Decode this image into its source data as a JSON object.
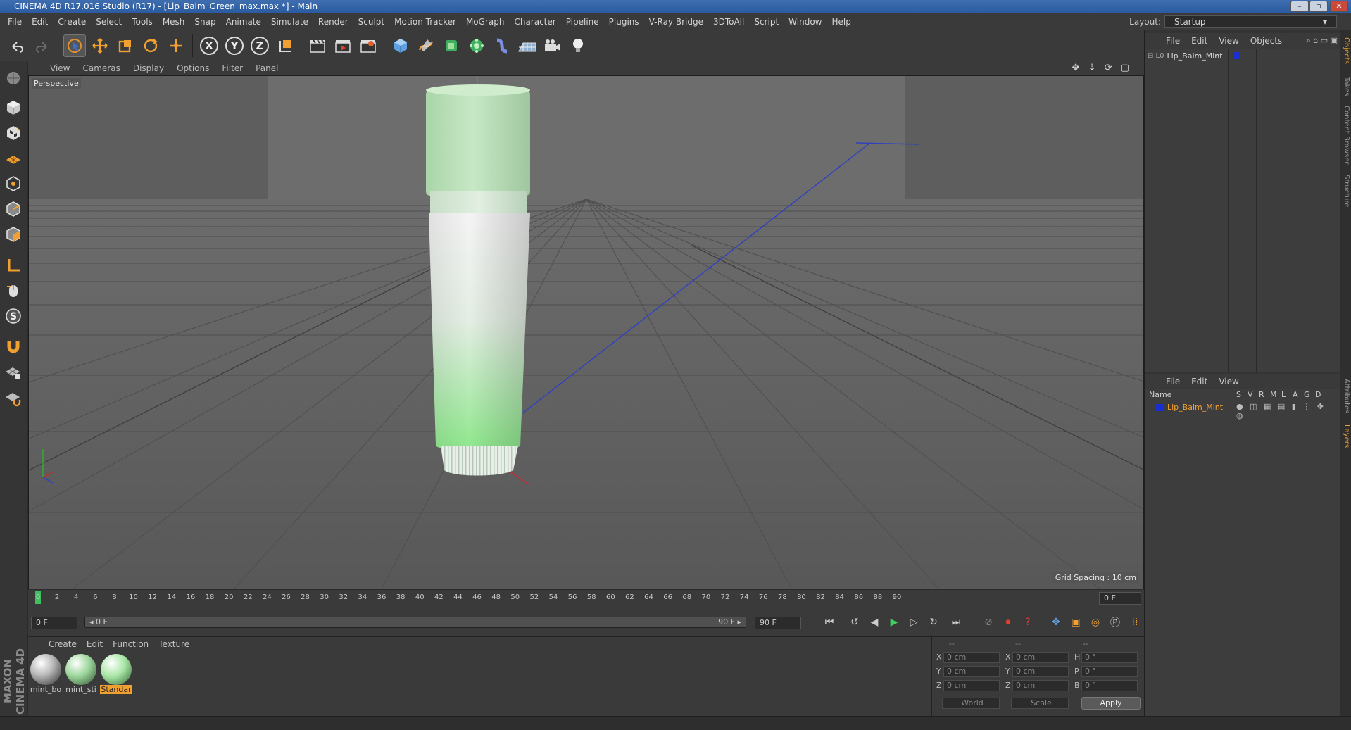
{
  "app": {
    "title": "CINEMA 4D R17.016 Studio (R17) - [Lip_Balm_Green_max.max *] - Main",
    "window_buttons": [
      "–",
      "▫",
      "✕"
    ]
  },
  "menubar": {
    "items": [
      "File",
      "Edit",
      "Create",
      "Select",
      "Tools",
      "Mesh",
      "Snap",
      "Animate",
      "Simulate",
      "Render",
      "Sculpt",
      "Motion Tracker",
      "MoGraph",
      "Character",
      "Pipeline",
      "Plugins",
      "V-Ray Bridge",
      "3DToAll",
      "Script",
      "Window",
      "Help"
    ],
    "layout_label": "Layout:",
    "layout_value": "Startup"
  },
  "toolbar": {
    "axis_x": "X",
    "axis_y": "Y",
    "axis_z": "Z"
  },
  "viewport": {
    "menu": [
      "View",
      "Cameras",
      "Display",
      "Options",
      "Filter",
      "Panel"
    ],
    "label": "Perspective",
    "grid_spacing": "Grid Spacing : 10 cm"
  },
  "timeline": {
    "ticks": [
      "0",
      "2",
      "4",
      "6",
      "8",
      "10",
      "12",
      "14",
      "16",
      "18",
      "20",
      "22",
      "24",
      "26",
      "28",
      "30",
      "32",
      "34",
      "36",
      "38",
      "40",
      "42",
      "44",
      "46",
      "48",
      "50",
      "52",
      "54",
      "56",
      "58",
      "60",
      "62",
      "64",
      "66",
      "68",
      "70",
      "72",
      "74",
      "76",
      "78",
      "80",
      "82",
      "84",
      "86",
      "88",
      "90"
    ],
    "current_frame": "0 F"
  },
  "transport": {
    "start_field": "0 F",
    "range_start": "◂ 0 F",
    "range_end": "90 F ▸",
    "end_field": "90 F"
  },
  "materials": {
    "menu": [
      "Create",
      "Edit",
      "Function",
      "Texture"
    ],
    "items": [
      {
        "name": "mint_bo",
        "selected": false
      },
      {
        "name": "mint_sti",
        "selected": false
      },
      {
        "name": "Standar",
        "selected": true
      }
    ]
  },
  "coordinates": {
    "headers": [
      "--",
      "--",
      "--"
    ],
    "rows": [
      {
        "a": "X",
        "av": "0 cm",
        "b": "X",
        "bv": "0 cm",
        "c": "H",
        "cv": "0 °"
      },
      {
        "a": "Y",
        "av": "0 cm",
        "b": "Y",
        "bv": "0 cm",
        "c": "P",
        "cv": "0 °"
      },
      {
        "a": "Z",
        "av": "0 cm",
        "b": "Z",
        "bv": "0 cm",
        "c": "B",
        "cv": "0 °"
      }
    ],
    "space": "World",
    "mode": "Scale",
    "apply": "Apply"
  },
  "objects_panel": {
    "menu": [
      "File",
      "Edit",
      "View",
      "Objects"
    ],
    "object_name": "Lip_Balm_Mint"
  },
  "layers_panel": {
    "menu": [
      "File",
      "Edit",
      "View"
    ],
    "columns": [
      "Name",
      "S",
      "V",
      "R",
      "M",
      "L",
      "A",
      "G",
      "D"
    ],
    "layer_name": "Lip_Balm_Mint"
  },
  "side_tabs": [
    "Objects",
    "Takes",
    "Content Browser",
    "Structure",
    "Attributes",
    "Layers"
  ],
  "brand": "MAXON CINEMA 4D",
  "colors": {
    "accent_orange": "#f0a030",
    "object_blue": "#1a2fd0",
    "balm_green": "#9be49a"
  }
}
